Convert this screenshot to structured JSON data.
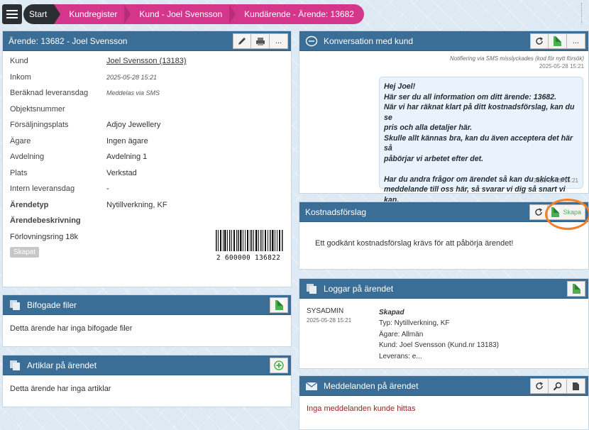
{
  "breadcrumbs": [
    "Start",
    "Kundregister",
    "Kund - Joel Svensson",
    "Kundärende - Ärende: 13682"
  ],
  "case_panel": {
    "title": "Ärende: 13682 - Joel Svensson",
    "rows": [
      {
        "label": "Kund",
        "value": "Joel Svensson (13183)"
      },
      {
        "label": "Inkom",
        "value": "2025-05-28 15:21"
      },
      {
        "label": "Beräknad leveransdag",
        "value": "Meddelas via SMS"
      },
      {
        "label": "Objektsnummer",
        "value": ""
      },
      {
        "label": "Försäljningsplats",
        "value": "Adjoy Jewellery"
      },
      {
        "label": "Ägare",
        "value": "Ingen ägare"
      },
      {
        "label": "Avdelning",
        "value": "Avdelning 1"
      },
      {
        "label": "Plats",
        "value": "Verkstad"
      },
      {
        "label": "Intern leveransdag",
        "value": "-"
      },
      {
        "label": "Ärendetyp",
        "value": "Nytillverkning, KF"
      },
      {
        "label": "Ärendebeskrivning",
        "value": ""
      }
    ],
    "description": "Förlovningsring 18k",
    "status_badge": "Skapat",
    "barcode_text": "2 600000 136822",
    "tools": {
      "more": "..."
    }
  },
  "files_panel": {
    "title": "Bifogade filer",
    "empty": "Detta ärende har inga bifogade filer"
  },
  "articles_panel": {
    "title": "Artiklar på ärendet",
    "empty": "Detta ärende har inga artiklar"
  },
  "conversation_panel": {
    "title": "Konversation med kund",
    "note": "Notifiering via SMS misslyckades (kod för nytt försök)",
    "note_ts": "2025-05-28 15:21",
    "message_lines": [
      "Hej Joel!",
      "Här ser du all information om ditt ärende: 13682.",
      "När vi har räknat klart på ditt kostnadsförslag, kan du se",
      "pris och alla detaljer här.",
      "Skulle allt kännas bra, kan du även acceptera det här så",
      "påbörjar vi arbetet efter det.",
      "",
      "Har du andra frågor om ärendet så kan du skicka ett",
      "meddelande till oss här, så svarar vi dig så snart vi kan."
    ],
    "message_ts": "2025-05-28 15:21"
  },
  "estimate_panel": {
    "title": "Kostnadsförslag",
    "create_label": "Skapa",
    "body": "Ett godkänt kostnadsförslag krävs för att påbörja ärendet!",
    "highlight_color": "#f0802a"
  },
  "logs_panel": {
    "title": "Loggar på ärendet",
    "user": "SYSADMIN",
    "date": "2025-05-28 15:21",
    "heading": "Skapad",
    "lines": [
      "Typ: Nytillverkning, KF",
      "Ägare: Allmän",
      "Kund: Joel Svensson (Kund.nr 13183)",
      "Leverans: e..."
    ]
  },
  "messages_panel": {
    "title": "Meddelanden på ärendet",
    "empty": "Inga meddelanden kunde hittas",
    "empty_color": "#9b1c1c"
  },
  "colors": {
    "header": "#3b6e96",
    "crumb_pink": "#d4368b",
    "crumb_dark": "#2b2f33"
  }
}
